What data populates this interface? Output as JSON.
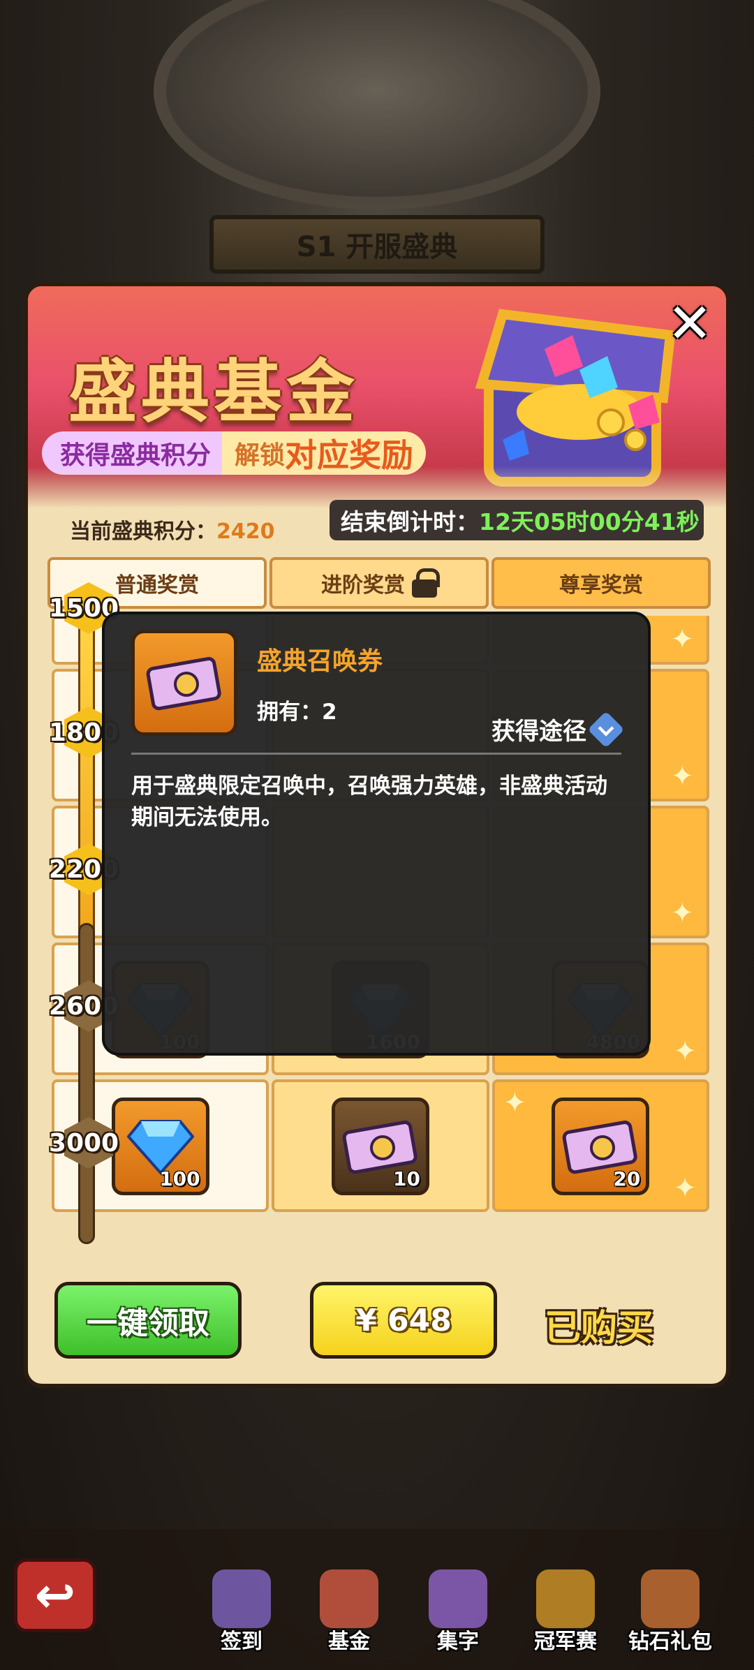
{
  "background": {
    "banner_title": "S1 开服盛典"
  },
  "header": {
    "title": "盛典基金",
    "subtitle_left": "获得盛典积分",
    "subtitle_right_prefix": "解锁",
    "subtitle_right_highlight": "对应奖励"
  },
  "points": {
    "label": "当前盛典积分：",
    "value": "2420"
  },
  "countdown": {
    "label": "结束倒计时：",
    "time": "12天05时00分41秒"
  },
  "tabs": [
    {
      "label": "普通奖赏"
    },
    {
      "label": "进阶奖赏"
    },
    {
      "label": "尊享奖赏"
    }
  ],
  "milestones": [
    "1500",
    "1800",
    "2200",
    "2600",
    "3000"
  ],
  "rewards": {
    "row_2600": [
      {
        "icon": "diamond-icon",
        "count": "100"
      },
      {
        "icon": "diamond-icon",
        "count": "1600"
      },
      {
        "icon": "diamond-icon",
        "count": "4800"
      }
    ],
    "row_3000": [
      {
        "icon": "diamond-icon",
        "count": "100"
      },
      {
        "icon": "ticket-icon",
        "count": "10"
      },
      {
        "icon": "ticket-icon",
        "count": "20"
      }
    ]
  },
  "buttons": {
    "claim_all": "一键领取",
    "price": "¥ 648",
    "purchased": "已购买"
  },
  "tooltip": {
    "name": "盛典召唤券",
    "owned": "拥有：2",
    "source": "获得途径",
    "description": "用于盛典限定召唤中，召唤强力英雄，非盛典活动期间无法使用。"
  },
  "bottom_nav": [
    {
      "label": "签到",
      "icon": "checkin-icon"
    },
    {
      "label": "基金",
      "icon": "fund-icon"
    },
    {
      "label": "集字",
      "icon": "collect-words-icon"
    },
    {
      "label": "冠军赛",
      "icon": "championship-icon"
    },
    {
      "label": "钻石礼包",
      "icon": "diamond-pack-icon"
    }
  ],
  "colors": {
    "accent_gold": "#ffd37a",
    "countdown_green": "#7ef05a",
    "points_orange": "#e07a1a"
  }
}
